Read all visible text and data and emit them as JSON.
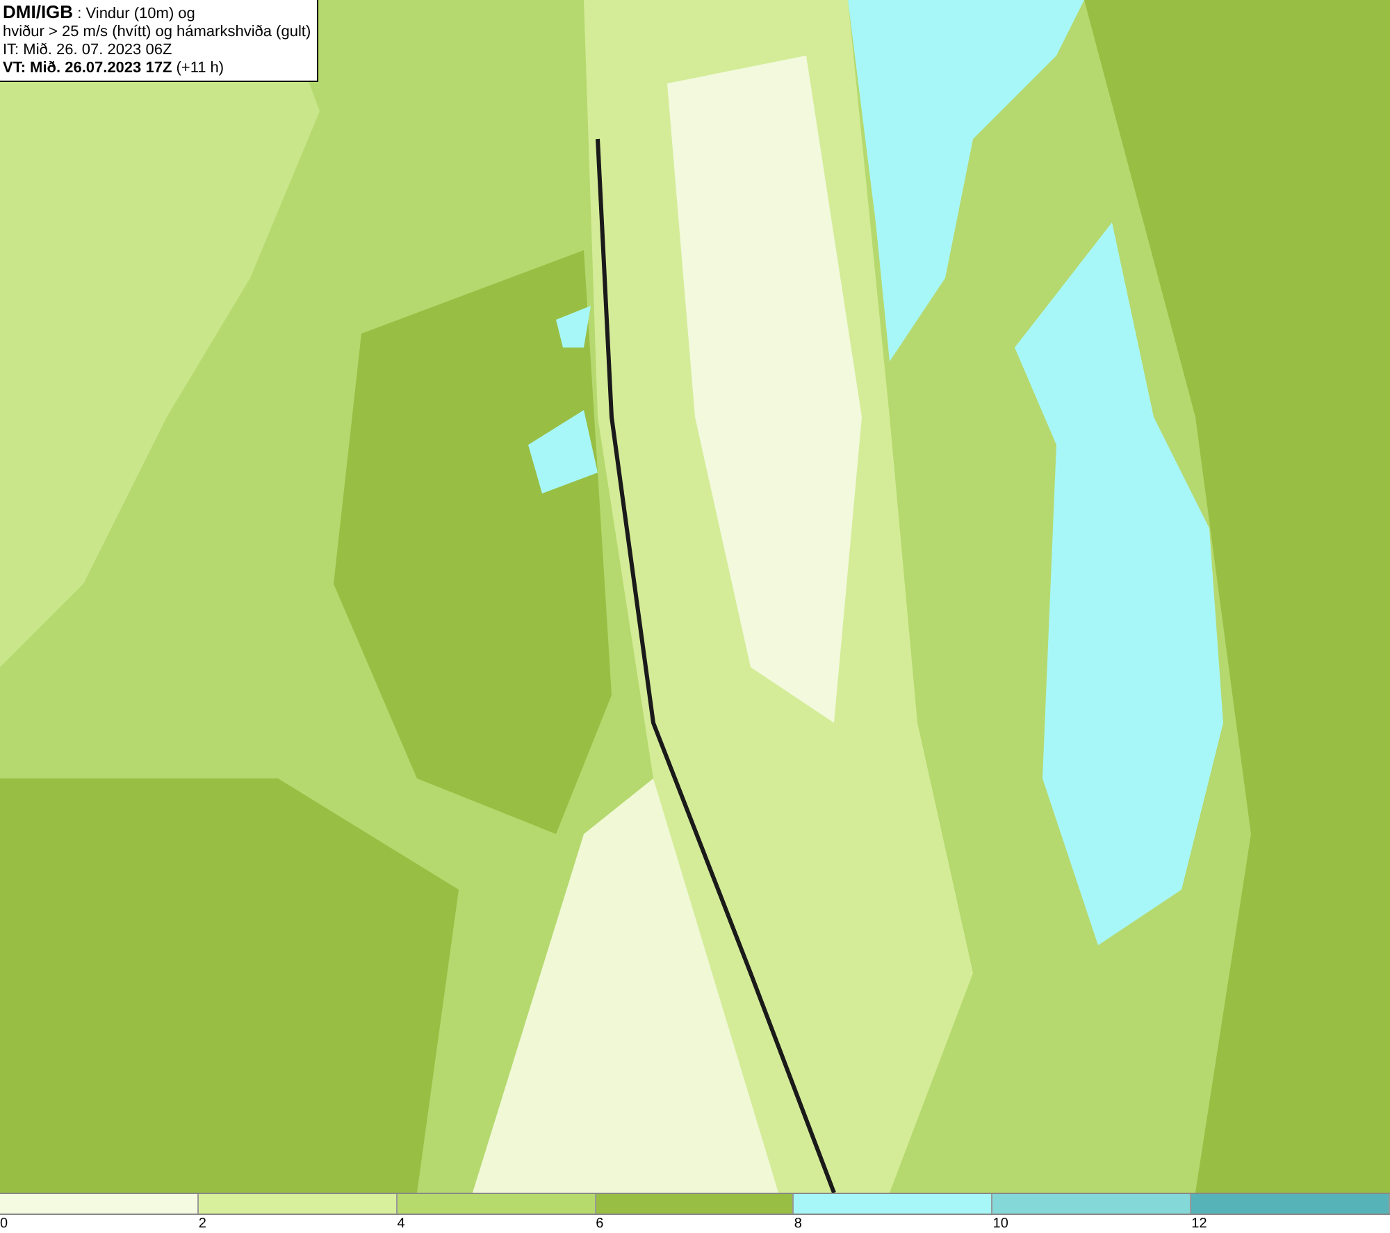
{
  "header": {
    "lines": [
      "**DMI/IGB** : Vindur (10m) og",
      "hviður > 25 m/s (hvítt) og hámarkshviða (gult)",
      "IT: Mið. 26. 07. 2023 06Z",
      "**VT: Mið. 26.07.2023 17Z** (+11 h)"
    ]
  },
  "legend": {
    "bins": [
      {
        "color": "#f5fbe0"
      },
      {
        "color": "#d8ef9c"
      },
      {
        "color": "#b6db6c"
      },
      {
        "color": "#98be44"
      },
      {
        "color": "#a8f7f8"
      },
      {
        "color": "#84d8d8"
      },
      {
        "color": "#56b4b8"
      }
    ],
    "ticks": [
      "0",
      "2",
      "4",
      "6",
      "8",
      "10",
      "12"
    ]
  }
}
